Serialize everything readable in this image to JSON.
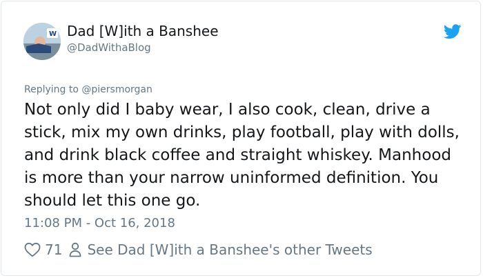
{
  "author": {
    "display_name": "Dad [W]ith a Banshee",
    "handle": "@DadWithaBlog"
  },
  "replying_to": "Replying to @piersmorgan",
  "tweet": {
    "text": "Not only did I baby wear, I also cook, clean, drive a stick, mix my own drinks, play football, play with dolls, and drink black coffee and straight whiskey. Manhood is more than your narrow uninformed definition. You should let this one go.",
    "timestamp": "11:08 PM - Oct 16, 2018"
  },
  "actions": {
    "likes": "71",
    "see_more": "See Dad [W]ith a Banshee's other Tweets"
  },
  "icons": {
    "avatar": "avatar-photo",
    "brand": "twitter-bird-icon",
    "like": "heart-outline-icon",
    "profile": "person-outline-icon"
  },
  "colors": {
    "brand": "#1da1f2",
    "text": "#14171a",
    "secondary": "#657786",
    "border": "#e1e8ed"
  }
}
